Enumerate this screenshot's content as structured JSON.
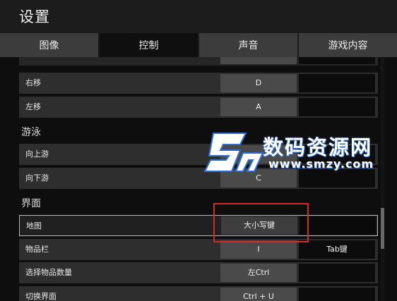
{
  "window": {
    "title": "设置"
  },
  "tabs": [
    {
      "label": "图像",
      "active": false
    },
    {
      "label": "控制",
      "active": true
    },
    {
      "label": "声音",
      "active": false
    },
    {
      "label": "游戏内容",
      "active": false
    }
  ],
  "sections": {
    "movement": {
      "rows": [
        {
          "label": "右移",
          "key1": "D",
          "key2": ""
        },
        {
          "label": "左移",
          "key1": "A",
          "key2": ""
        }
      ]
    },
    "swim": {
      "title": "游泳",
      "rows": [
        {
          "label": "向上游",
          "key1": "",
          "key2": ""
        },
        {
          "label": "向下游",
          "key1": "C",
          "key2": ""
        }
      ]
    },
    "interface": {
      "title": "界面",
      "rows": [
        {
          "label": "地图",
          "key1": "大小写键",
          "key2": ""
        },
        {
          "label": "物品栏",
          "key1": "I",
          "key2": "Tab键"
        },
        {
          "label": "选择物品数量",
          "key1": "左Ctrl",
          "key2": ""
        },
        {
          "label": "切换界面",
          "key1": "Ctrl + U",
          "key2": ""
        }
      ]
    }
  },
  "watermark": {
    "line1": "数码资源网",
    "line2": "www.smzy.com"
  },
  "colors": {
    "highlight": "#d42a2a",
    "watermark_accent": "#2b6fd6"
  }
}
